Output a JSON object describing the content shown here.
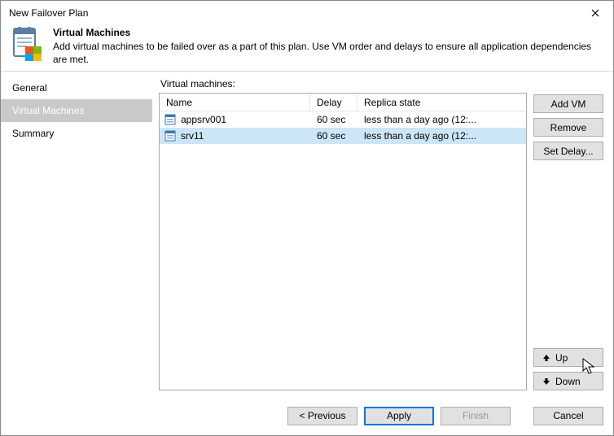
{
  "window": {
    "title": "New Failover Plan"
  },
  "header": {
    "heading": "Virtual Machines",
    "subheading": "Add virtual machines to be failed over as a part of this plan. Use VM order and delays to ensure all application dependencies are met."
  },
  "sidebar": {
    "items": [
      {
        "label": "General",
        "selected": false
      },
      {
        "label": "Virtual Machines",
        "selected": true
      },
      {
        "label": "Summary",
        "selected": false
      }
    ]
  },
  "table": {
    "label": "Virtual machines:",
    "columns": {
      "name": "Name",
      "delay": "Delay",
      "state": "Replica state"
    },
    "rows": [
      {
        "name": "appsrv001",
        "delay": "60 sec",
        "state": "less than a day ago (12:...",
        "selected": false
      },
      {
        "name": "srv11",
        "delay": "60 sec",
        "state": "less than a day ago (12:...",
        "selected": true
      }
    ]
  },
  "buttons": {
    "add": "Add VM",
    "remove": "Remove",
    "setdelay": "Set Delay...",
    "up": "Up",
    "down": "Down"
  },
  "footer": {
    "previous": "< Previous",
    "apply": "Apply",
    "finish": "Finish",
    "cancel": "Cancel",
    "finish_enabled": false
  }
}
